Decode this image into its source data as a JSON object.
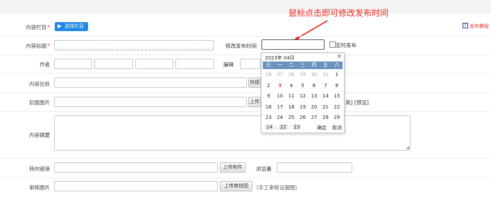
{
  "annotation": "鼠标点击即可修改发布时间",
  "help_link": "发布教程",
  "form": {
    "column": {
      "label": "内容栏目",
      "button": "选择栏目"
    },
    "title": {
      "label": "内容标题"
    },
    "publish_time": {
      "label": "修改发布时间",
      "value": "",
      "scheduled_label": "定时发布"
    },
    "author": {
      "label": "作者"
    },
    "editor": {
      "label": "编辑"
    },
    "source": {
      "label": "内容出处",
      "button": "快捷"
    },
    "cover": {
      "label": "封面图片",
      "button": "上传",
      "after_text": "[预览]",
      "partial_text": "高]"
    },
    "summary": {
      "label": "内容摘要"
    },
    "redirect": {
      "label": "转向链接",
      "button": "上传附件",
      "views_label": "浏览量"
    },
    "review_image": {
      "label": "审核图片",
      "button": "上传审核图",
      "note": "(手工审核证据图)"
    }
  },
  "calendar": {
    "year_label": "2023年",
    "month_label": "04月",
    "close": "×",
    "weekdays": [
      "日",
      "一",
      "二",
      "三",
      "四",
      "五",
      "六"
    ],
    "weeks": [
      [
        "26",
        "27",
        "28",
        "29",
        "30",
        "31",
        "1"
      ],
      [
        "2",
        "3",
        "4",
        "5",
        "6",
        "7",
        "8"
      ],
      [
        "9",
        "10",
        "11",
        "12",
        "13",
        "14",
        "15"
      ],
      [
        "16",
        "17",
        "18",
        "19",
        "20",
        "21",
        "22"
      ],
      [
        "23",
        "24",
        "25",
        "26",
        "27",
        "28",
        "29"
      ]
    ],
    "hour": "14",
    "minute": "22",
    "second": "23",
    "sep": ":",
    "confirm": "确定",
    "cancel": "取消"
  }
}
